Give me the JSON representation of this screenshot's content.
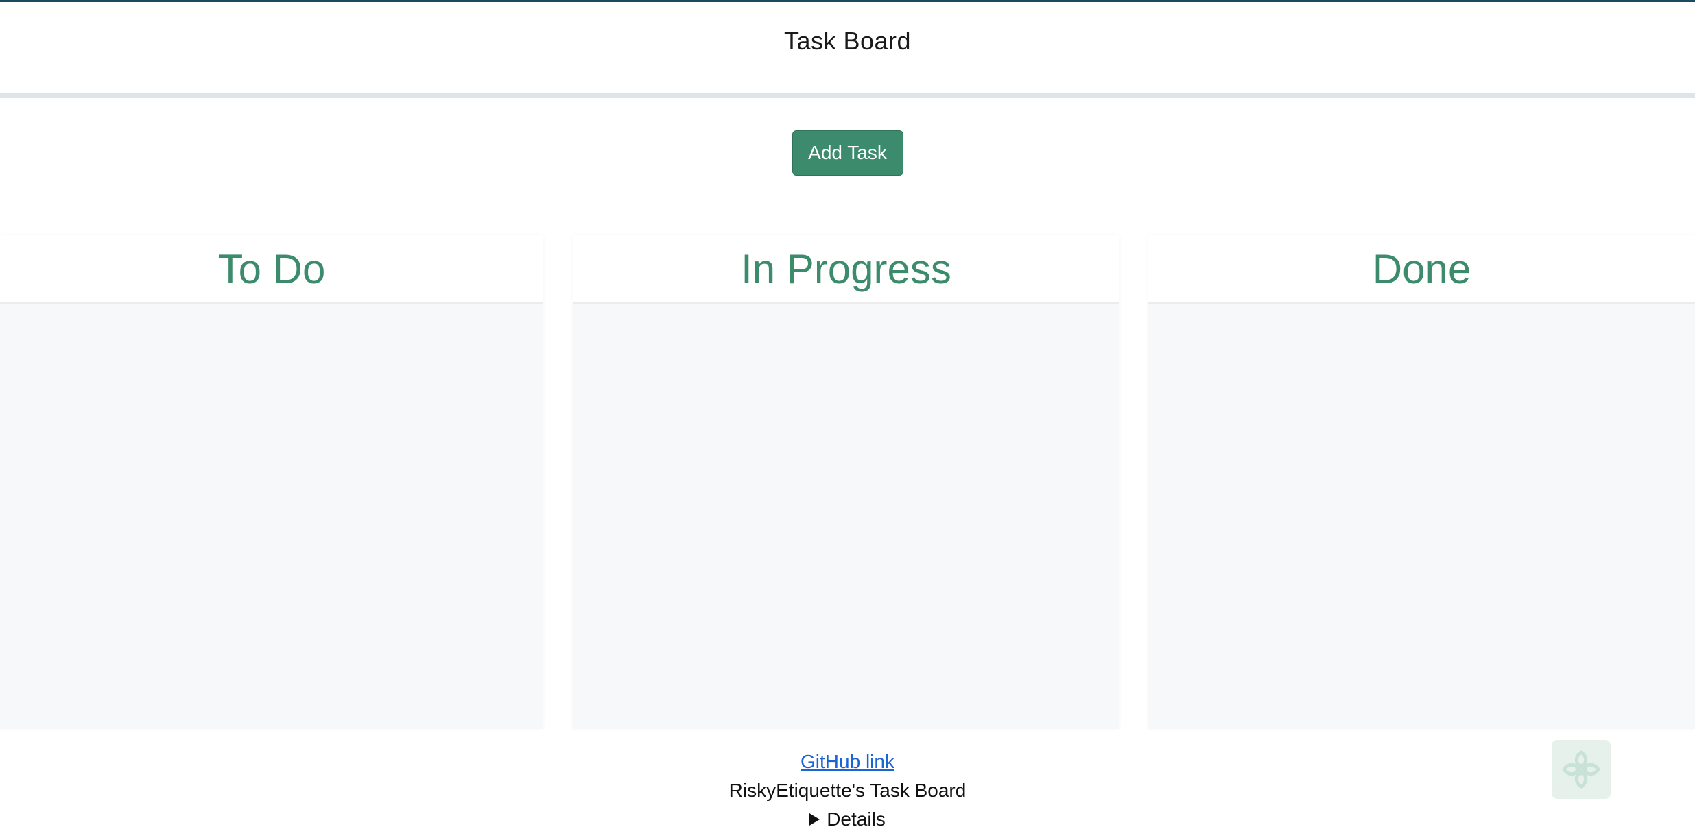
{
  "header": {
    "title": "Task Board"
  },
  "toolbar": {
    "add_task_label": "Add Task"
  },
  "columns": [
    {
      "title": "To Do"
    },
    {
      "title": "In Progress"
    },
    {
      "title": "Done"
    }
  ],
  "footer": {
    "github_link_label": "GitHub link",
    "caption": "RiskyEtiquette's Task Board",
    "details_label": "Details"
  },
  "icons": {
    "corner_badge": "flower-logo-icon",
    "details_marker": "triangle-right-icon"
  },
  "colors": {
    "accent": "#3c8b6c",
    "link": "#1a64d6",
    "column_body": "#f7f8fa"
  }
}
